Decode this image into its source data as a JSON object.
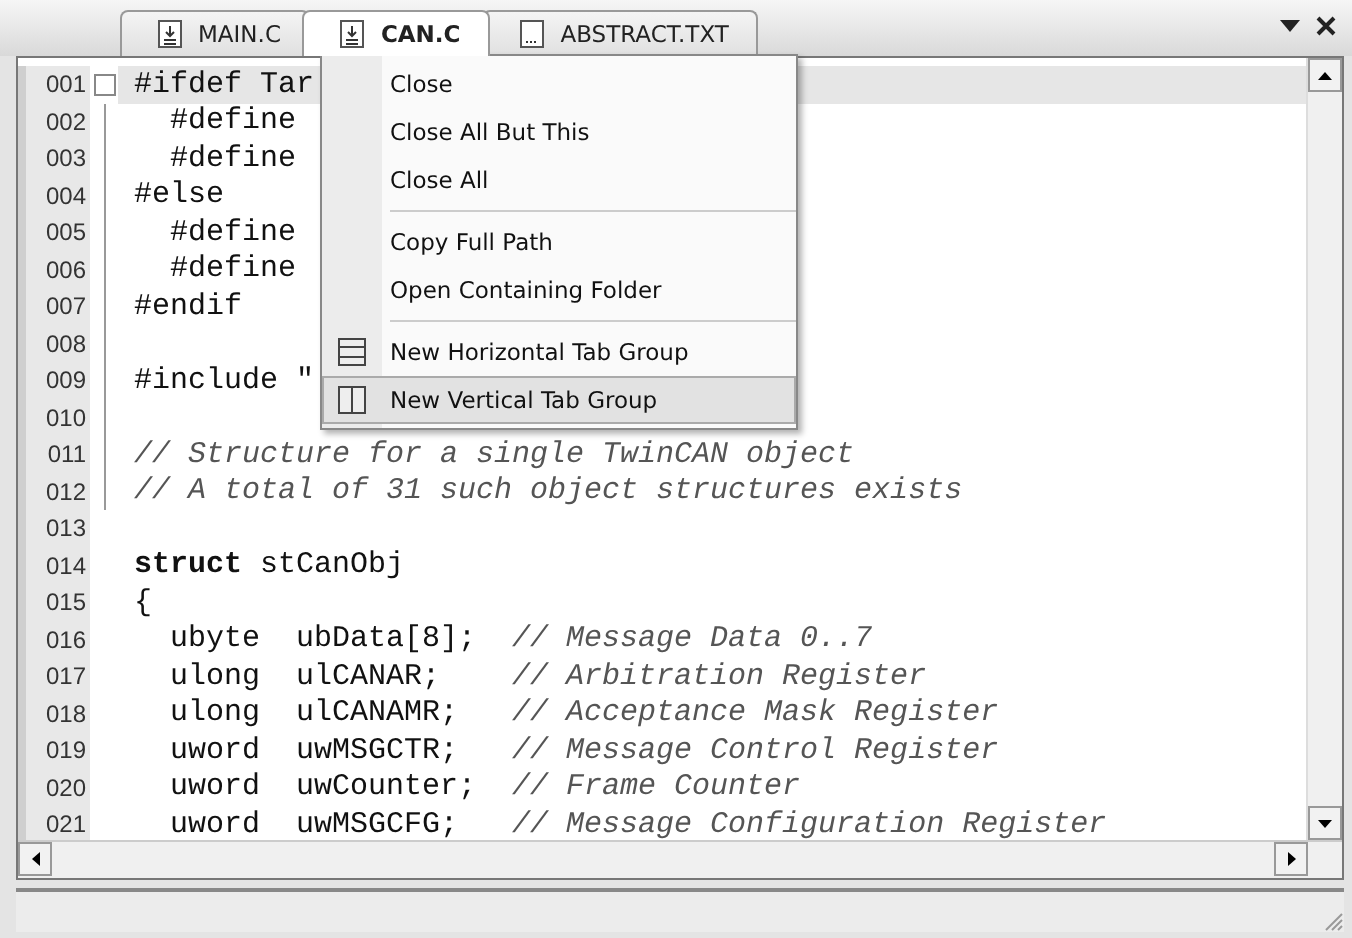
{
  "tabs": [
    {
      "label": "MAIN.C",
      "kind": "source",
      "selected": false
    },
    {
      "label": "CAN.C",
      "kind": "source",
      "selected": true
    },
    {
      "label": "ABSTRACT.TXT",
      "kind": "text",
      "selected": false
    }
  ],
  "editor": {
    "lines": [
      {
        "number": "001",
        "current": true,
        "kind": "fold_start",
        "segments": [
          {
            "text": "#ifdef Tar",
            "kind": "plain"
          }
        ]
      },
      {
        "number": "002",
        "current": false,
        "kind": "fold_body",
        "segments": [
          {
            "text": "  #define",
            "kind": "plain"
          }
        ]
      },
      {
        "number": "003",
        "current": false,
        "kind": "fold_body",
        "segments": [
          {
            "text": "  #define",
            "kind": "plain"
          }
        ]
      },
      {
        "number": "004",
        "current": false,
        "kind": "fold_body",
        "segments": [
          {
            "text": "#else",
            "kind": "plain"
          }
        ]
      },
      {
        "number": "005",
        "current": false,
        "kind": "fold_body",
        "segments": [
          {
            "text": "  #define",
            "kind": "plain"
          }
        ]
      },
      {
        "number": "006",
        "current": false,
        "kind": "fold_body",
        "segments": [
          {
            "text": "  #define",
            "kind": "plain"
          }
        ]
      },
      {
        "number": "007",
        "current": false,
        "kind": "fold_body",
        "segments": [
          {
            "text": "#endif",
            "kind": "plain"
          }
        ]
      },
      {
        "number": "008",
        "current": false,
        "kind": "fold_body"
      },
      {
        "number": "009",
        "current": false,
        "kind": "fold_body",
        "segments": [
          {
            "text": "#include \"",
            "kind": "plain"
          }
        ]
      },
      {
        "number": "010",
        "current": false,
        "kind": "fold_body"
      },
      {
        "number": "011",
        "current": false,
        "kind": "fold_body",
        "segments": [
          {
            "text": "// Structure for a single TwinCAN object",
            "kind": "comment"
          }
        ]
      },
      {
        "number": "012",
        "current": false,
        "kind": "fold_body",
        "segments": [
          {
            "text": "// A total of 31 such object structures exists",
            "kind": "comment"
          }
        ]
      },
      {
        "number": "013",
        "current": false,
        "kind": "plain"
      },
      {
        "number": "014",
        "current": false,
        "kind": "plain",
        "segments": [
          {
            "text": "struct",
            "kind": "keyword"
          },
          {
            "text": " stCanObj",
            "kind": "plain"
          }
        ]
      },
      {
        "number": "015",
        "current": false,
        "kind": "plain",
        "segments": [
          {
            "text": "{",
            "kind": "plain"
          }
        ]
      },
      {
        "number": "016",
        "current": false,
        "kind": "plain",
        "segments": [
          {
            "text": "  ubyte  ubData[8];  ",
            "kind": "plain"
          },
          {
            "text": "// Message Data 0..7",
            "kind": "comment"
          }
        ]
      },
      {
        "number": "017",
        "current": false,
        "kind": "plain",
        "segments": [
          {
            "text": "  ulong  ulCANAR;    ",
            "kind": "plain"
          },
          {
            "text": "// Arbitration Register",
            "kind": "comment"
          }
        ]
      },
      {
        "number": "018",
        "current": false,
        "kind": "plain",
        "segments": [
          {
            "text": "  ulong  ulCANAMR;   ",
            "kind": "plain"
          },
          {
            "text": "// Acceptance Mask Register",
            "kind": "comment"
          }
        ]
      },
      {
        "number": "019",
        "current": false,
        "kind": "plain",
        "segments": [
          {
            "text": "  uword  uwMSGCTR;   ",
            "kind": "plain"
          },
          {
            "text": "// Message Control Register",
            "kind": "comment"
          }
        ]
      },
      {
        "number": "020",
        "current": false,
        "kind": "plain",
        "segments": [
          {
            "text": "  uword  uwCounter;  ",
            "kind": "plain"
          },
          {
            "text": "// Frame Counter",
            "kind": "comment"
          }
        ]
      },
      {
        "number": "021",
        "current": false,
        "kind": "plain",
        "segments": [
          {
            "text": "  uword  uwMSGCFG;   ",
            "kind": "plain"
          },
          {
            "text": "// Message Configuration Register",
            "kind": "comment"
          }
        ]
      }
    ]
  },
  "context_menu": {
    "items": [
      {
        "kind": "item",
        "label": "Close",
        "selected": false
      },
      {
        "kind": "item",
        "label": "Close All But This",
        "selected": false
      },
      {
        "kind": "item",
        "label": "Close All",
        "selected": false
      },
      {
        "kind": "separator"
      },
      {
        "kind": "item",
        "label": "Copy Full Path",
        "selected": false
      },
      {
        "kind": "item",
        "label": "Open Containing Folder",
        "selected": false
      },
      {
        "kind": "separator"
      },
      {
        "kind": "horizontal_split",
        "label": "New Horizontal Tab Group",
        "selected": false
      },
      {
        "kind": "vertical_split",
        "label": "New Vertical Tab Group",
        "selected": true
      }
    ]
  }
}
